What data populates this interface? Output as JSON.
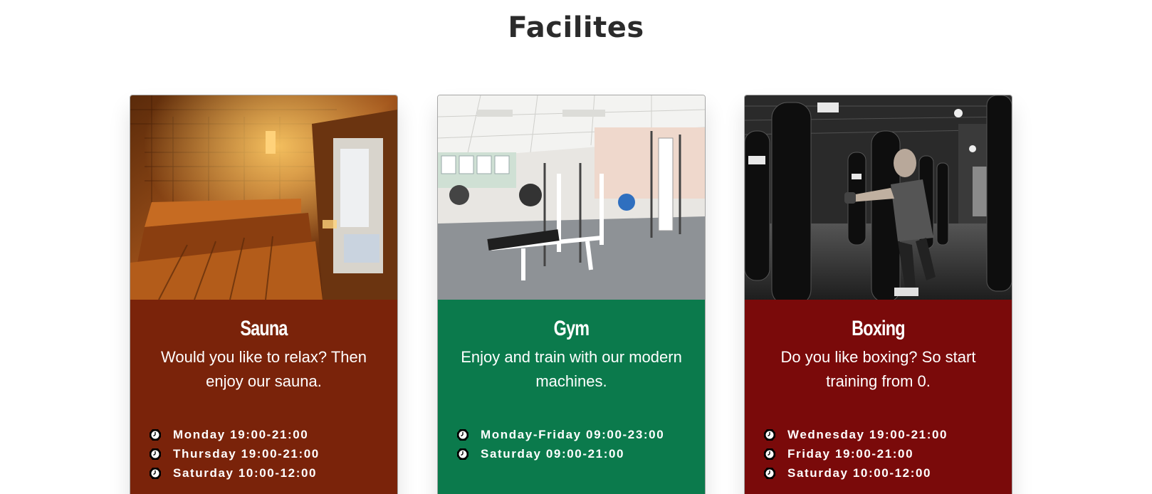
{
  "page": {
    "title": "Facilites"
  },
  "cards": [
    {
      "title": "Sauna",
      "description": "Would you like to relax? Then enjoy our sauna.",
      "color": "#7a230a",
      "image": "sauna-photo",
      "hours": [
        "Monday 19:00-21:00",
        "Thursday 19:00-21:00",
        "Saturday 10:00-12:00"
      ]
    },
    {
      "title": "Gym",
      "description": "Enjoy and train with our modern machines.",
      "color": "#0b7a4c",
      "image": "gym-photo",
      "hours": [
        "Monday-Friday 09:00-23:00",
        "Saturday 09:00-21:00"
      ]
    },
    {
      "title": "Boxing",
      "description": "Do you like boxing? So start training from 0.",
      "color": "#7a0a0a",
      "image": "boxing-photo",
      "hours": [
        "Wednesday 19:00-21:00",
        "Friday 19:00-21:00",
        "Saturday 10:00-12:00"
      ]
    }
  ],
  "icons": {
    "hours_icon": "clock-icon"
  }
}
